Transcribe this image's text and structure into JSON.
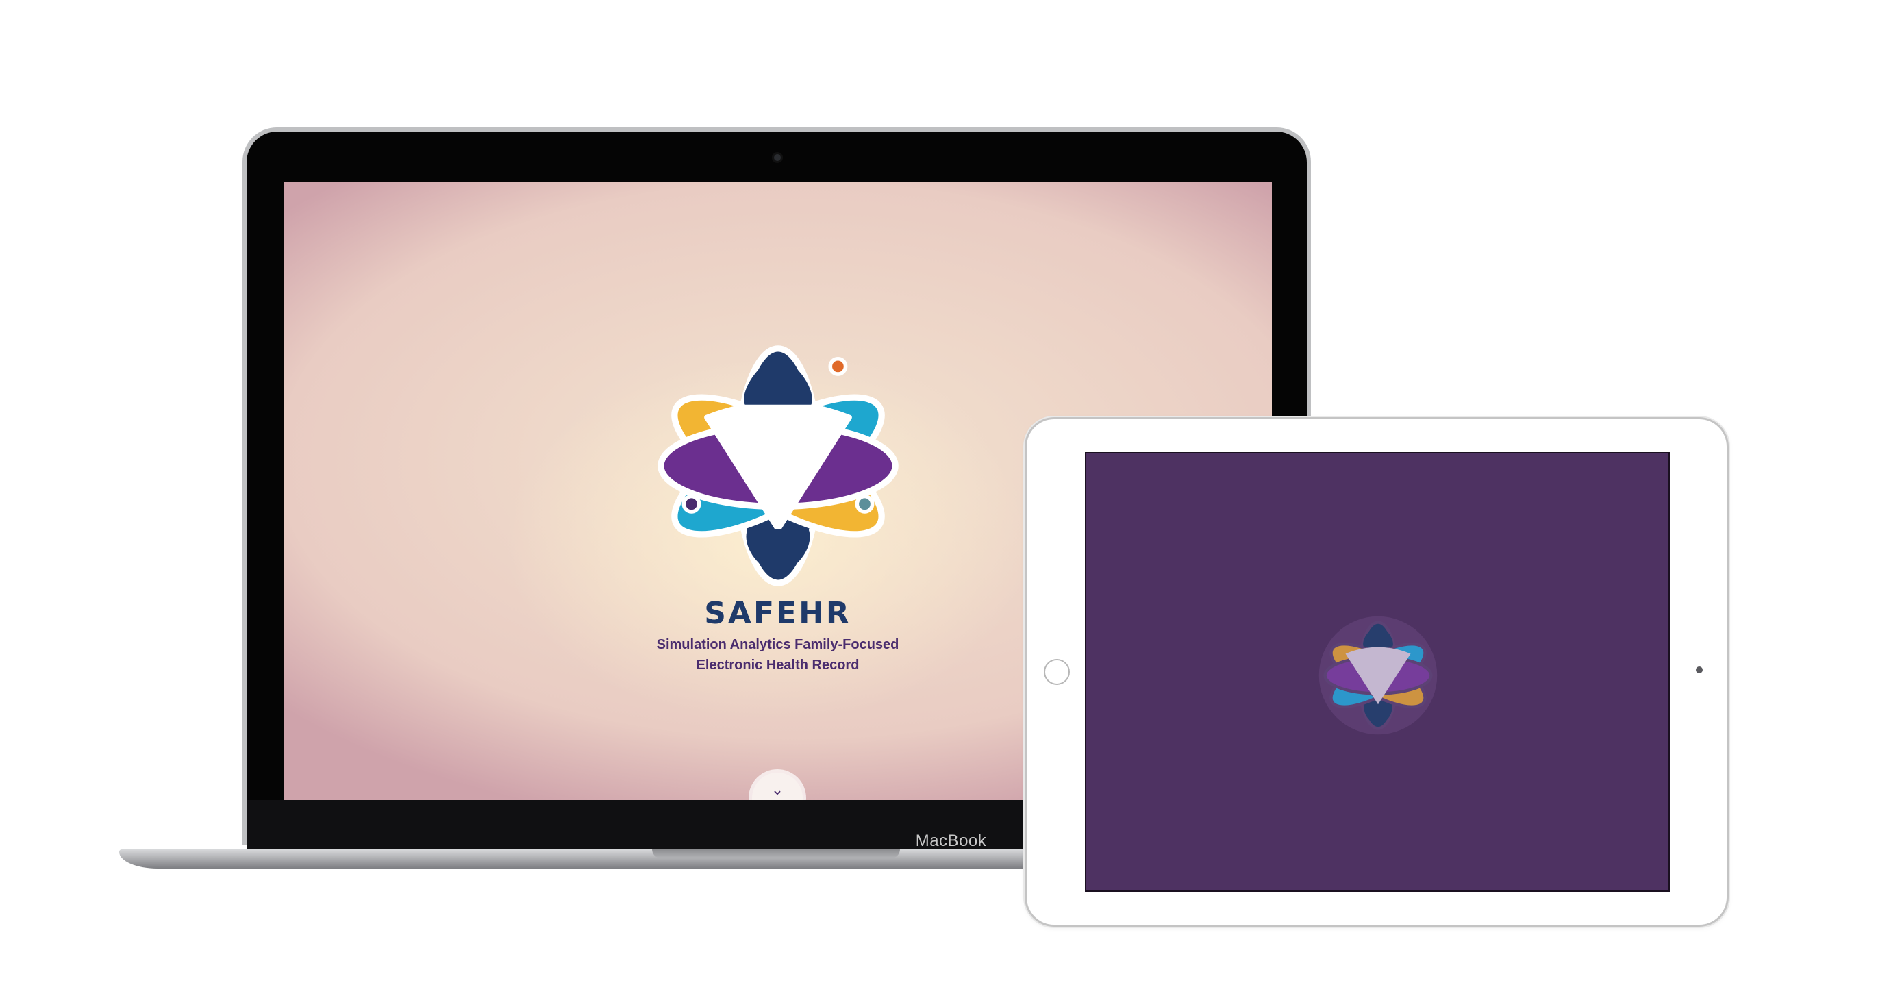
{
  "laptop": {
    "brand_label": "MacBook",
    "website": {
      "title": "SAFEHR",
      "subtitle_line1": "Simulation Analytics Family-Focused",
      "subtitle_line2": "Electronic Health Record",
      "scroll_button_icon": "chevron-down-icon"
    }
  },
  "tablet": {
    "screen_color": "#4e3262",
    "content": "splash-logo"
  },
  "colors": {
    "navy": "#1f3a6a",
    "purple": "#6b2f8f",
    "teal": "#1ea7cf",
    "gold": "#f2b533",
    "orange": "#e06a2a"
  }
}
